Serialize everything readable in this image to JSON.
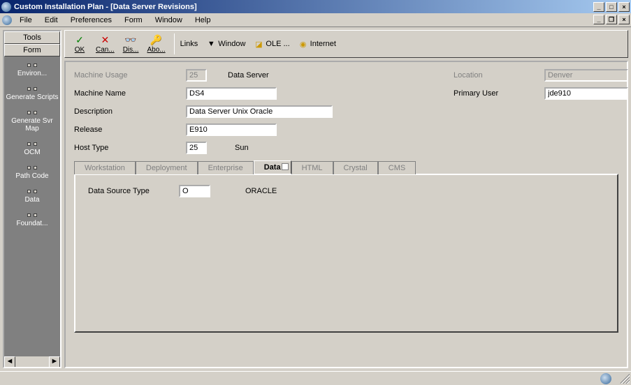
{
  "window": {
    "title": "Custom Installation Plan - [Data Server Revisions]"
  },
  "menu": {
    "items": [
      "File",
      "Edit",
      "Preferences",
      "Form",
      "Window",
      "Help"
    ]
  },
  "sidebar": {
    "tabs": [
      "Tools",
      "Form"
    ],
    "items": [
      "Environ...",
      "Generate Scripts",
      "Generate Svr Map",
      "OCM",
      "Path Code",
      "Data",
      "Foundat..."
    ]
  },
  "toolbar": {
    "buttons": [
      {
        "id": "ok",
        "label": "OK",
        "icon": "✓",
        "color": "#008000"
      },
      {
        "id": "cancel",
        "label": "Can...",
        "icon": "✕",
        "color": "#cc0000"
      },
      {
        "id": "display",
        "label": "Dis...",
        "icon": "👓",
        "color": "#333"
      },
      {
        "id": "about",
        "label": "Abo...",
        "icon": "🔑",
        "color": "#b8860b"
      }
    ],
    "links_label": "Links",
    "links": [
      {
        "id": "window",
        "label": "Window",
        "icon": "▼"
      },
      {
        "id": "ole",
        "label": "OLE ...",
        "icon": "◥"
      },
      {
        "id": "internet",
        "label": "Internet",
        "icon": "◉"
      }
    ]
  },
  "form": {
    "machine_usage_label": "Machine Usage",
    "machine_usage_value": "25",
    "machine_usage_text": "Data Server",
    "location_label": "Location",
    "location_value": "Denver",
    "machine_name_label": "Machine Name",
    "machine_name_value": "DS4",
    "primary_user_label": "Primary User",
    "primary_user_value": "jde910",
    "description_label": "Description",
    "description_value": "Data Server Unix Oracle",
    "release_label": "Release",
    "release_value": "E910",
    "host_type_label": "Host Type",
    "host_type_value": "25",
    "host_type_text": "Sun"
  },
  "tabs": {
    "list": [
      "Workstation",
      "Deployment",
      "Enterprise",
      "Data",
      "HTML",
      "Crystal",
      "CMS"
    ],
    "active": "Data",
    "data_pane": {
      "dst_label": "Data Source Type",
      "dst_value": "O",
      "dst_text": "ORACLE"
    }
  }
}
